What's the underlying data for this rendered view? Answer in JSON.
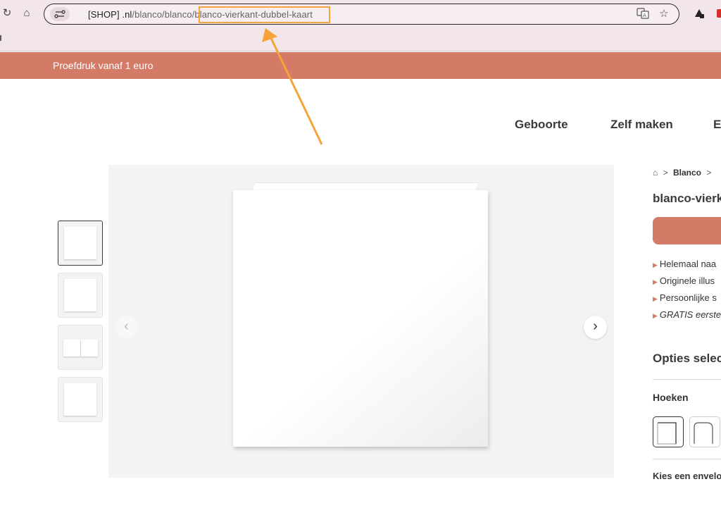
{
  "browser": {
    "url_domain": "[SHOP] .nl",
    "url_path": "/blanco/blanco/",
    "url_slug": "blanco-vierkant-dubbel-kaart",
    "icons": [
      "reload-icon",
      "home-icon",
      "site-settings-icon",
      "translate-icon",
      "star-icon",
      "extension-icon"
    ]
  },
  "promo": {
    "text": "Proefdruk vanaf 1 euro",
    "color": "#d47b67"
  },
  "main_nav": {
    "items": [
      "Geboorte",
      "Zelf maken",
      "E"
    ]
  },
  "gallery": {
    "thumbnails": [
      "thumb-1",
      "thumb-2",
      "thumb-3",
      "thumb-4"
    ],
    "prev_glyph": "‹",
    "next_glyph": "›"
  },
  "product": {
    "breadcrumb_home_glyph": "⌂",
    "breadcrumb_sep": ">",
    "breadcrumb_item": "Blanco",
    "title": "blanco-vierk",
    "usps": [
      "Helemaal naa",
      "Originele illus",
      "Persoonlijke s",
      "GRATIS eerste"
    ],
    "options_heading": "Opties selec",
    "corners_label": "Hoeken",
    "envelope_label": "Kies een envelo"
  },
  "annotation": {
    "color": "#f7a23a"
  }
}
